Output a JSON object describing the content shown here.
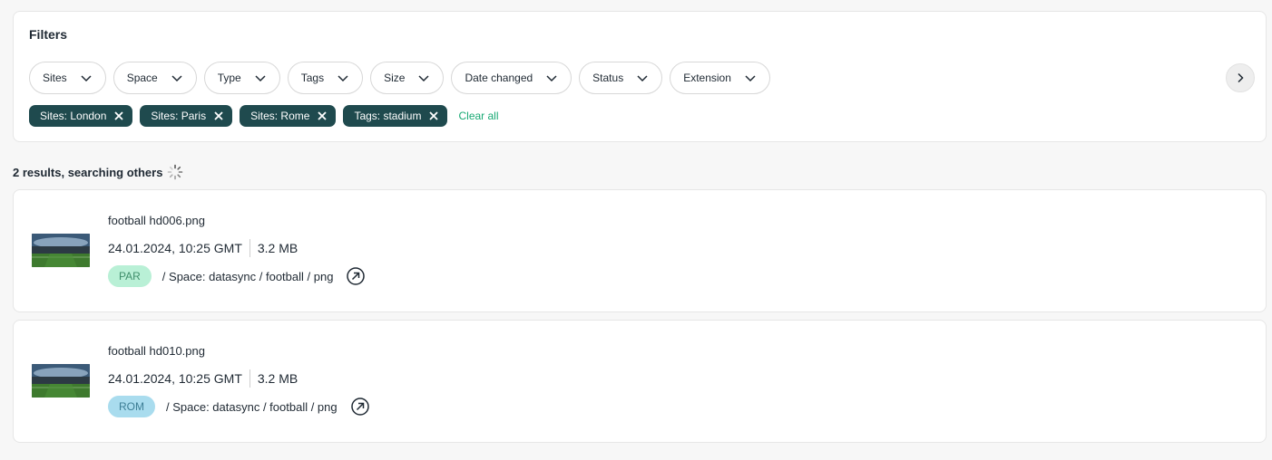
{
  "filters": {
    "title": "Filters",
    "dropdowns": [
      {
        "label": "Sites"
      },
      {
        "label": "Space"
      },
      {
        "label": "Type"
      },
      {
        "label": "Tags"
      },
      {
        "label": "Size"
      },
      {
        "label": "Date changed"
      },
      {
        "label": "Status"
      },
      {
        "label": "Extension"
      }
    ],
    "active_chips": [
      {
        "label": "Sites: London"
      },
      {
        "label": "Sites: Paris"
      },
      {
        "label": "Sites: Rome"
      },
      {
        "label": "Tags: stadium"
      }
    ],
    "clear_all_label": "Clear all",
    "chip_color": "#1f4a4e",
    "clear_all_color": "#19a974"
  },
  "results": {
    "summary": "2 results, searching others",
    "items": [
      {
        "name": "football hd006.png",
        "date": "24.01.2024, 10:25 GMT",
        "size": "3.2 MB",
        "site_badge": "PAR",
        "badge_bg": "#b9f0d6",
        "badge_fg": "#3f8f6b",
        "path": "/ Space: datasync / football / png",
        "icon": "open-external-icon"
      },
      {
        "name": "football hd010.png",
        "date": "24.01.2024, 10:25 GMT",
        "size": "3.2 MB",
        "site_badge": "ROM",
        "badge_bg": "#a9dcee",
        "badge_fg": "#3d7e95",
        "path": "/ Space: datasync / football / png",
        "icon": "open-external-icon"
      }
    ]
  }
}
